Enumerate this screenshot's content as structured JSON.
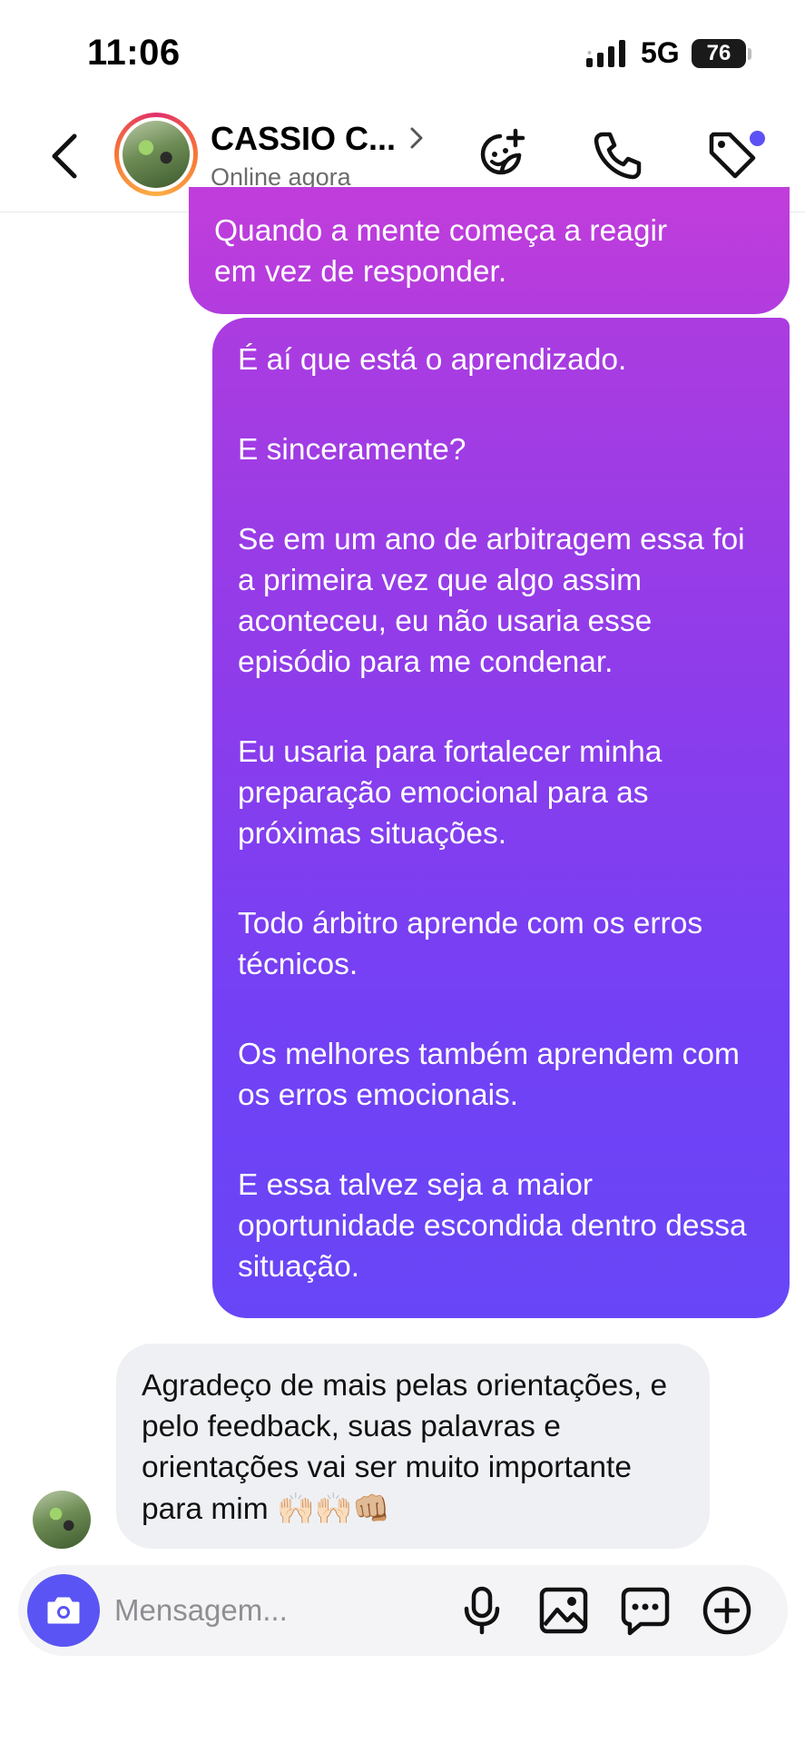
{
  "status_bar": {
    "time": "11:06",
    "network": "5G",
    "battery": "76"
  },
  "header": {
    "contact_name": "CASSIO C...",
    "contact_status": "Online agora",
    "icons": [
      "back-icon",
      "avatar",
      "chevron-right-icon",
      "add-sticker-icon",
      "phone-icon",
      "tag-icon"
    ],
    "notification_dot_color": "#5b51f5"
  },
  "messages": {
    "outgoing_top": {
      "line1": "Quando a mente começa a reagir",
      "line2": "em vez de responder."
    },
    "outgoing_main": {
      "p1": "É aí que está o aprendizado.",
      "p2": "E sinceramente?",
      "p3": "Se em um ano de arbitragem essa foi a primeira vez que algo assim aconteceu, eu não usaria esse episódio para me condenar.",
      "p4": "Eu usaria para fortalecer minha preparação emocional para as próximas situações.",
      "p5": "Todo árbitro aprende com os erros técnicos.",
      "p6": "Os melhores também aprendem com os erros emocionais.",
      "p7": "E essa talvez seja a maior oportunidade escondida dentro dessa situação."
    },
    "incoming": {
      "text": "Agradeço de mais pelas orientações, e pelo feedback, suas palavras e orientações vai ser muito importante para mim",
      "emojis": "🙌🏻🙌🏻👊🏼"
    }
  },
  "composer": {
    "placeholder": "Mensagem...",
    "icons": [
      "camera-icon",
      "microphone-icon",
      "gallery-icon",
      "sticker-chat-icon",
      "add-icon"
    ]
  },
  "colors": {
    "accent": "#5a54f4",
    "bubble_gradient_start": "#c13ddb",
    "bubble_gradient_end": "#6846f7",
    "incoming_bubble": "#eff0f4"
  }
}
